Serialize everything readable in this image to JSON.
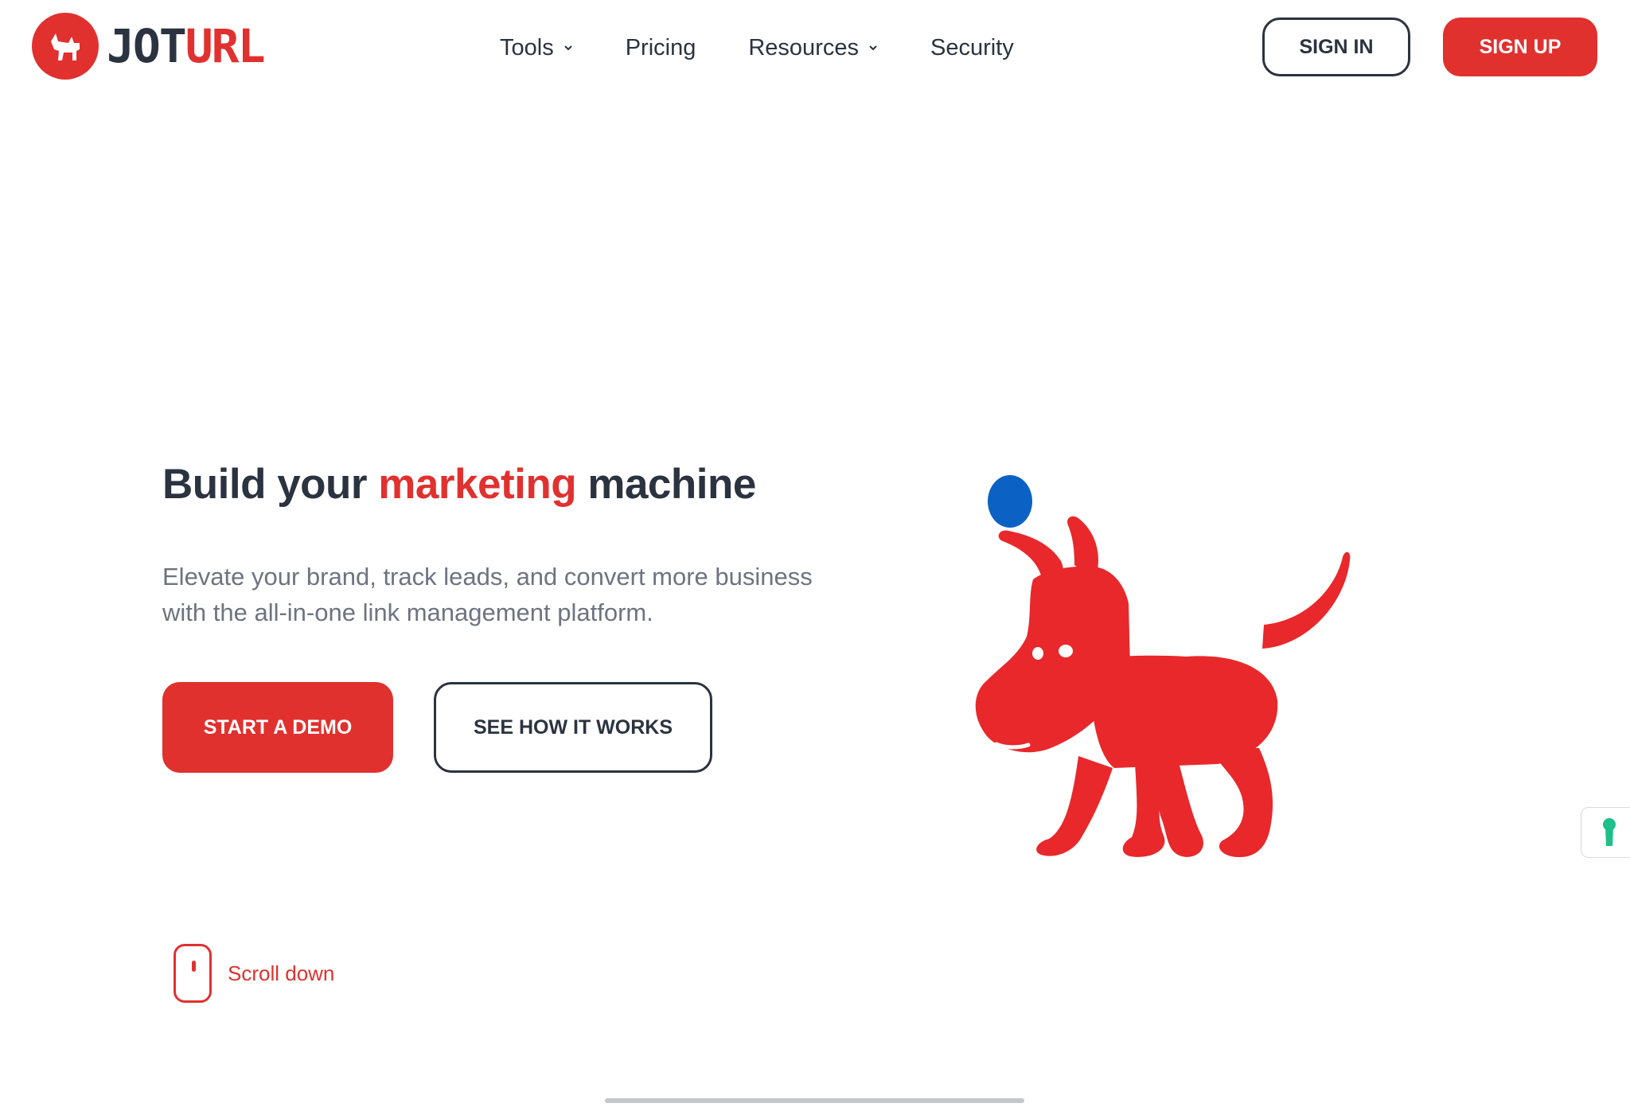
{
  "brand": {
    "logo_text_part1": "JOT",
    "logo_text_part2": "URL",
    "accent_color": "#e0312f",
    "dark_color": "#2b3340",
    "muted_color": "#6e7380"
  },
  "nav": {
    "items": [
      {
        "label": "Tools",
        "has_dropdown": true
      },
      {
        "label": "Pricing",
        "has_dropdown": false
      },
      {
        "label": "Resources",
        "has_dropdown": true
      },
      {
        "label": "Security",
        "has_dropdown": false
      }
    ]
  },
  "header": {
    "signin_label": "SIGN IN",
    "signup_label": "SIGN UP"
  },
  "hero": {
    "title_before": "Build your ",
    "title_accent": "marketing",
    "title_after": " machine",
    "subtitle": "Elevate your brand, track leads, and convert more business with the all-in-one link management platform.",
    "primary_button": "START A DEMO",
    "secondary_button": "SEE HOW IT WORKS",
    "scroll_label": "Scroll down"
  },
  "illustration": {
    "subject": "dog-with-ball",
    "dog_color": "#e8282b",
    "ball_color": "#0c62c4"
  },
  "side_widget": {
    "icon": "keyhole-icon",
    "icon_color": "#1fbf8a"
  }
}
